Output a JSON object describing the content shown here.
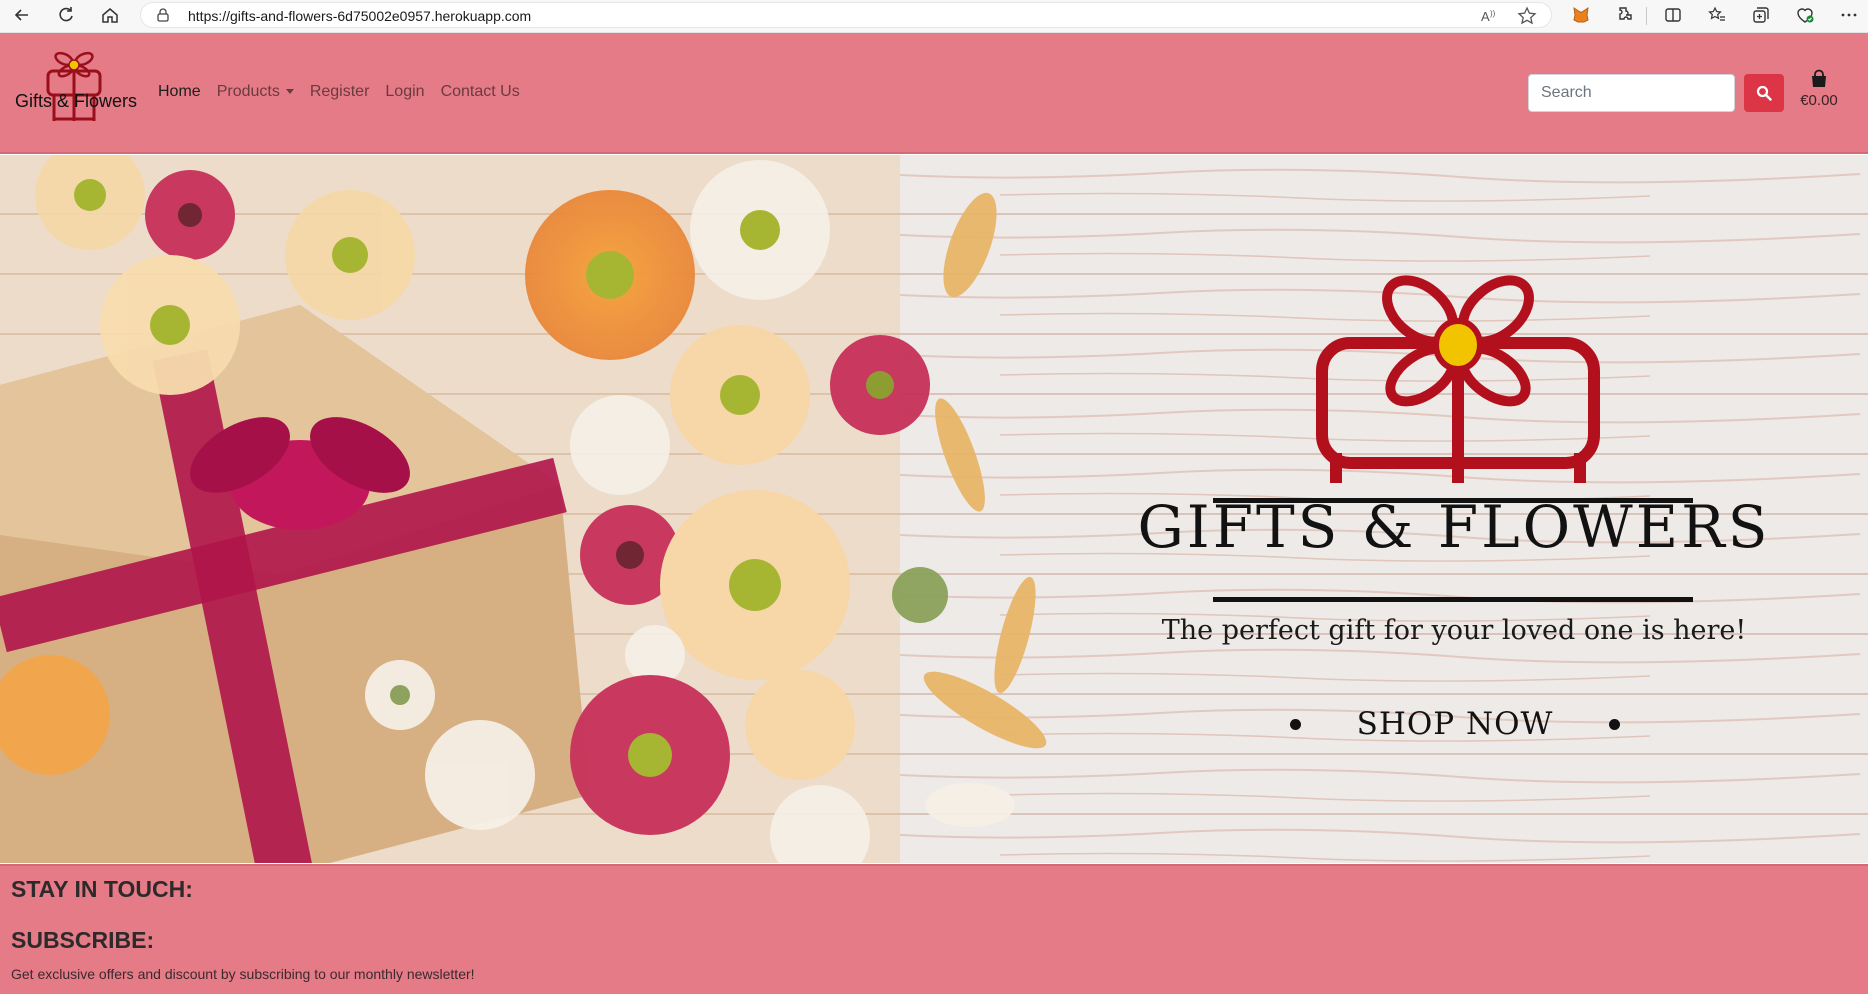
{
  "browser": {
    "url": "https://gifts-and-flowers-6d75002e0957.herokuapp.com",
    "icons": [
      "back-icon",
      "refresh-icon",
      "home-icon",
      "lock-icon",
      "read-aloud-icon",
      "favorite-star-icon",
      "metamask-fox-icon",
      "extensions-icon",
      "split-screen-icon",
      "favorites-icon",
      "collections-icon",
      "browser-essentials-icon",
      "more-icon"
    ]
  },
  "header": {
    "logo_text": "Gifts & Flowers",
    "nav": {
      "home": "Home",
      "products": "Products",
      "register": "Register",
      "login": "Login",
      "contact": "Contact Us"
    },
    "search_placeholder": "Search",
    "bag_total": "€0.00"
  },
  "hero": {
    "brand": "GIFTS & FLOWERS",
    "tagline": "The perfect gift for your loved one is here!",
    "cta": "SHOP NOW"
  },
  "footer": {
    "stay_in_touch": "STAY IN TOUCH:",
    "subscribe": "SUBSCRIBE:",
    "newsletter_text": "Get exclusive offers and discount by subscribing to our monthly newsletter!"
  },
  "colors": {
    "header_bg": "#e57b86",
    "accent_red": "#dc3545",
    "logo_red": "#b3101e",
    "flower_yellow": "#f2c400"
  }
}
